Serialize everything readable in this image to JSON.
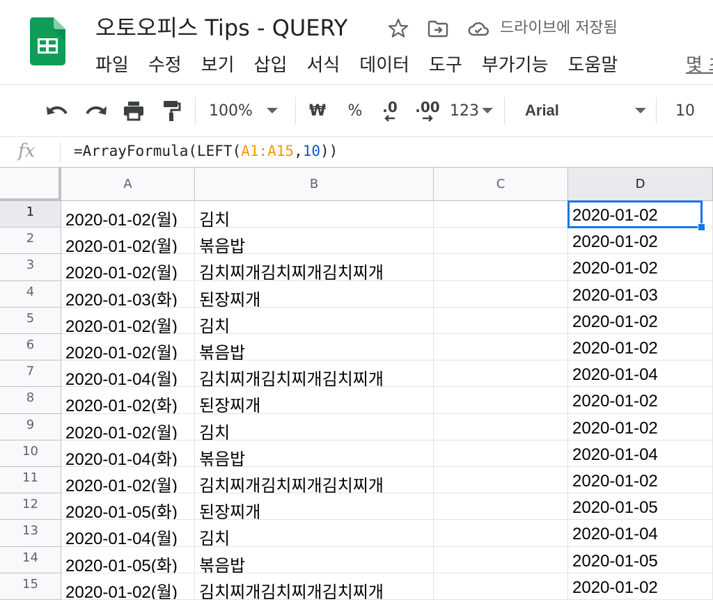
{
  "header": {
    "doc_title": "오토오피스 Tips - QUERY",
    "save_status": "드라이브에 저장됨",
    "menu": [
      "파일",
      "수정",
      "보기",
      "삽입",
      "서식",
      "데이터",
      "도구",
      "부가기능",
      "도움말"
    ],
    "menu_last": "몇 초"
  },
  "toolbar": {
    "zoom": "100%",
    "currency": "₩",
    "percent": "%",
    "decimal_less": ".0",
    "decimal_more": ".00",
    "number_format": "123",
    "font": "Arial",
    "font_size": "10"
  },
  "formula_bar": {
    "fx": "fx",
    "parts": [
      {
        "text": "=ArrayFormula(LEFT(",
        "kind": "plain"
      },
      {
        "text": "A1:A15",
        "kind": "range"
      },
      {
        "text": ",",
        "kind": "plain"
      },
      {
        "text": "10",
        "kind": "num"
      },
      {
        "text": "))",
        "kind": "plain"
      }
    ]
  },
  "sheet": {
    "columns": [
      "A",
      "B",
      "C",
      "D"
    ],
    "selected_column": "D",
    "selected_row": 1,
    "rows": [
      {
        "n": "1",
        "A": "2020-01-02(월)",
        "B": "김치",
        "C": "",
        "D": "2020-01-02"
      },
      {
        "n": "2",
        "A": "2020-01-02(월)",
        "B": "볶음밥",
        "C": "",
        "D": "2020-01-02"
      },
      {
        "n": "3",
        "A": "2020-01-02(월)",
        "B": "김치찌개김치찌개김치찌개",
        "C": "",
        "D": "2020-01-02"
      },
      {
        "n": "4",
        "A": "2020-01-03(화)",
        "B": "된장찌개",
        "C": "",
        "D": "2020-01-03"
      },
      {
        "n": "5",
        "A": "2020-01-02(월)",
        "B": "김치",
        "C": "",
        "D": "2020-01-02"
      },
      {
        "n": "6",
        "A": "2020-01-02(월)",
        "B": "볶음밥",
        "C": "",
        "D": "2020-01-02"
      },
      {
        "n": "7",
        "A": "2020-01-04(월)",
        "B": "김치찌개김치찌개김치찌개",
        "C": "",
        "D": "2020-01-04"
      },
      {
        "n": "8",
        "A": "2020-01-02(화)",
        "B": "된장찌개",
        "C": "",
        "D": "2020-01-02"
      },
      {
        "n": "9",
        "A": "2020-01-02(월)",
        "B": "김치",
        "C": "",
        "D": "2020-01-02"
      },
      {
        "n": "10",
        "A": "2020-01-04(화)",
        "B": "볶음밥",
        "C": "",
        "D": "2020-01-04"
      },
      {
        "n": "11",
        "A": "2020-01-02(월)",
        "B": "김치찌개김치찌개김치찌개",
        "C": "",
        "D": "2020-01-02"
      },
      {
        "n": "12",
        "A": "2020-01-05(화)",
        "B": "된장찌개",
        "C": "",
        "D": "2020-01-05"
      },
      {
        "n": "13",
        "A": "2020-01-04(월)",
        "B": "김치",
        "C": "",
        "D": "2020-01-04"
      },
      {
        "n": "14",
        "A": "2020-01-05(화)",
        "B": "볶음밥",
        "C": "",
        "D": "2020-01-05"
      },
      {
        "n": "15",
        "A": "2020-01-02(월)",
        "B": "김치찌개김치찌개김치찌개",
        "C": "",
        "D": "2020-01-02"
      }
    ]
  },
  "colors": {
    "sheets_green": "#0f9d58",
    "selection_blue": "#1a73e8",
    "range_orange": "#f29900",
    "number_blue": "#1155cc"
  }
}
